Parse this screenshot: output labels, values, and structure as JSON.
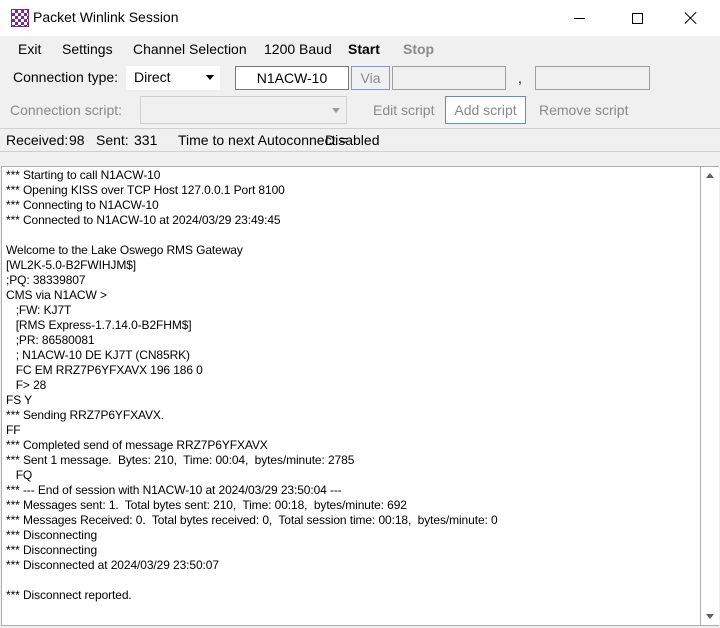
{
  "window": {
    "title": "Packet Winlink Session",
    "icon": "checkered-app-icon",
    "controls": [
      "minimize-icon",
      "maximize-icon",
      "close-icon"
    ]
  },
  "menu": {
    "items": [
      {
        "label": "Exit"
      },
      {
        "label": "Settings"
      },
      {
        "label": "Channel Selection"
      },
      {
        "label": "1200 Baud"
      },
      {
        "label": "Start"
      },
      {
        "label": "Stop"
      }
    ]
  },
  "connection": {
    "type_label": "Connection type:",
    "type_value": "Direct",
    "callsign": "N1ACW-10",
    "via_label": "Via",
    "via_field_1": "",
    "separator": ",",
    "via_field_2": ""
  },
  "script": {
    "label": "Connection script:",
    "value": "",
    "edit_label": "Edit script",
    "add_label": "Add script",
    "remove_label": "Remove script"
  },
  "status": {
    "received_label": "Received:",
    "received_value": "98",
    "sent_label": "Sent:",
    "sent_value": "331",
    "autoconnect_label": "Time to next Autoconnect =",
    "autoconnect_value": "Disabled"
  },
  "log": {
    "lines": [
      "*** Starting to call N1ACW-10",
      "*** Opening KISS over TCP Host 127.0.0.1 Port 8100",
      "*** Connecting to N1ACW-10",
      "*** Connected to N1ACW-10 at 2024/03/29 23:49:45",
      "",
      "Welcome to the Lake Oswego RMS Gateway",
      "[WL2K-5.0-B2FWIHJM$]",
      ";PQ: 38339807",
      "CMS via N1ACW >",
      "   ;FW: KJ7T",
      "   [RMS Express-1.7.14.0-B2FHM$]",
      "   ;PR: 86580081",
      "   ; N1ACW-10 DE KJ7T (CN85RK)",
      "   FC EM RRZ7P6YFXAVX 196 186 0",
      "   F> 28",
      "FS Y",
      "*** Sending RRZ7P6YFXAVX.",
      "FF",
      "*** Completed send of message RRZ7P6YFXAVX",
      "*** Sent 1 message.  Bytes: 210,  Time: 00:04,  bytes/minute: 2785",
      "   FQ",
      "*** --- End of session with N1ACW-10 at 2024/03/29 23:50:04 ---",
      "*** Messages sent: 1.  Total bytes sent: 210,  Time: 00:18,  bytes/minute: 692",
      "*** Messages Received: 0.  Total bytes received: 0,  Total session time: 00:18,  bytes/minute: 0",
      "*** Disconnecting",
      "*** Disconnecting",
      "*** Disconnected at 2024/03/29 23:50:07",
      "",
      "*** Disconnect reported."
    ]
  }
}
